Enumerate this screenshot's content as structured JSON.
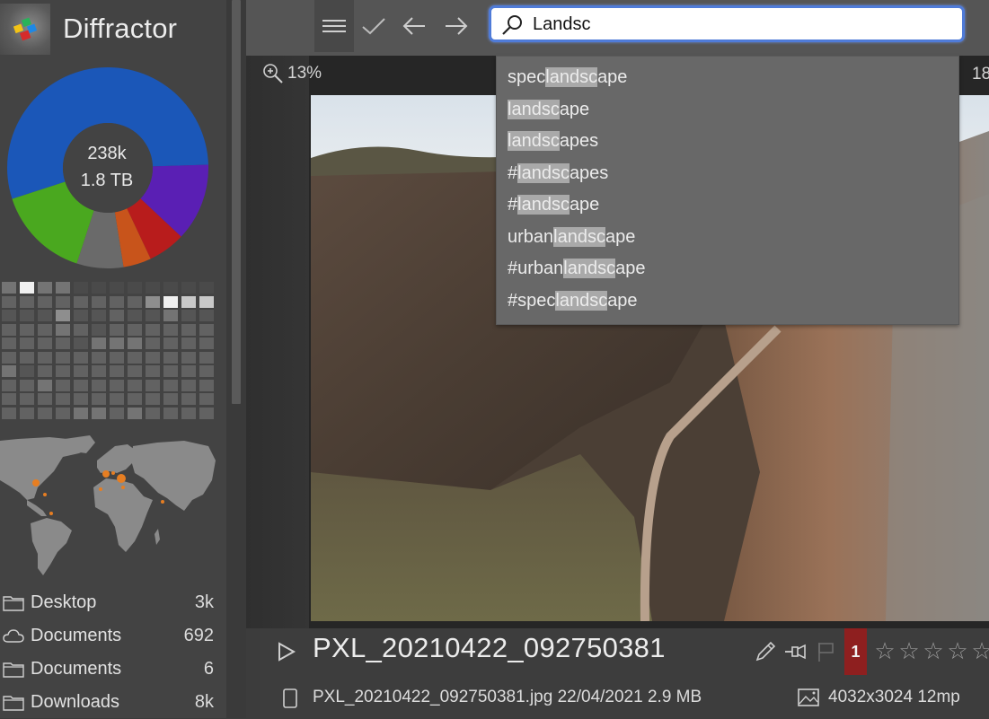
{
  "app": {
    "title": "Diffractor"
  },
  "sidebar": {
    "donut": {
      "count_label": "238k",
      "size_label": "1.8 TB",
      "segments": [
        {
          "name": "blue",
          "fraction": 0.545,
          "color": "#1b57b8"
        },
        {
          "name": "purple",
          "fraction": 0.125,
          "color": "#5a1fb4"
        },
        {
          "name": "red",
          "fraction": 0.06,
          "color": "#b81c1c"
        },
        {
          "name": "orange",
          "fraction": 0.045,
          "color": "#c8541b"
        },
        {
          "name": "gray",
          "fraction": 0.075,
          "color": "#6a6a6a"
        },
        {
          "name": "green",
          "fraction": 0.15,
          "color": "#4aa81f"
        }
      ],
      "start_segment_offset": 0.7,
      "inner_color": "#434343"
    },
    "heatmap": {
      "columns": 12,
      "levels": [
        [
          3,
          6,
          3,
          3,
          0,
          0,
          0,
          0,
          0,
          0,
          0,
          0
        ],
        [
          2,
          2,
          2,
          2,
          2,
          2,
          2,
          2,
          4,
          6,
          5,
          5
        ],
        [
          1,
          1,
          1,
          4,
          1,
          1,
          2,
          1,
          1,
          3,
          1,
          1
        ],
        [
          2,
          2,
          2,
          3,
          2,
          1,
          2,
          2,
          2,
          2,
          2,
          2
        ],
        [
          2,
          2,
          2,
          2,
          1,
          3,
          3,
          3,
          2,
          2,
          2,
          2
        ],
        [
          2,
          2,
          2,
          2,
          2,
          2,
          2,
          2,
          2,
          2,
          2,
          2
        ],
        [
          3,
          1,
          2,
          2,
          2,
          2,
          2,
          2,
          2,
          2,
          2,
          2
        ],
        [
          2,
          2,
          3,
          2,
          2,
          2,
          2,
          2,
          2,
          2,
          2,
          2
        ],
        [
          2,
          2,
          2,
          2,
          2,
          2,
          2,
          2,
          2,
          2,
          2,
          2
        ],
        [
          2,
          2,
          2,
          2,
          3,
          3,
          2,
          3,
          2,
          2,
          2,
          2
        ]
      ],
      "palette": [
        "#4a4a4a",
        "#555555",
        "#626262",
        "#747474",
        "#8e8e8e",
        "#c8c8c8",
        "#f0f0f0"
      ]
    },
    "map": {
      "land_color": "#8a8a8a",
      "marker_color": "#e67e22"
    },
    "folders": [
      {
        "icon": "folder-icon",
        "name": "Desktop",
        "count": "3k"
      },
      {
        "icon": "cloud-icon",
        "name": "Documents",
        "count": "692"
      },
      {
        "icon": "folder-icon",
        "name": "Documents",
        "count": "6"
      },
      {
        "icon": "folder-icon",
        "name": "Downloads",
        "count": "8k"
      }
    ]
  },
  "toolbar": {
    "menu_icon": "hamburger-menu-icon",
    "check_icon": "checkmark-icon",
    "back_icon": "arrow-left-icon",
    "forward_icon": "arrow-right-icon",
    "search": {
      "value": "Landsc",
      "placeholder": ""
    },
    "accent_color": "#4f7bd8"
  },
  "viewer": {
    "zoom_level": "13%",
    "right_counter": "18"
  },
  "suggestions": [
    {
      "pre": "spec",
      "match": "landsc",
      "post": "ape"
    },
    {
      "pre": "",
      "match": "landsc",
      "post": "ape"
    },
    {
      "pre": "",
      "match": "landsc",
      "post": "apes"
    },
    {
      "pre": "#",
      "match": "landsc",
      "post": "apes"
    },
    {
      "pre": "#",
      "match": "landsc",
      "post": "ape"
    },
    {
      "pre": "urban",
      "match": "landsc",
      "post": "ape"
    },
    {
      "pre": "#urban",
      "match": "landsc",
      "post": "ape"
    },
    {
      "pre": "#spec",
      "match": "landsc",
      "post": "ape"
    }
  ],
  "info": {
    "title": "PXL_20210422_092750381",
    "badge_count": "1",
    "badge_color": "#8e1f1f",
    "rating": 0,
    "rating_max": 5,
    "file_meta": "PXL_20210422_092750381.jpg 22/04/2021 2.9 MB",
    "image_meta": "4032x3024 12mp"
  }
}
